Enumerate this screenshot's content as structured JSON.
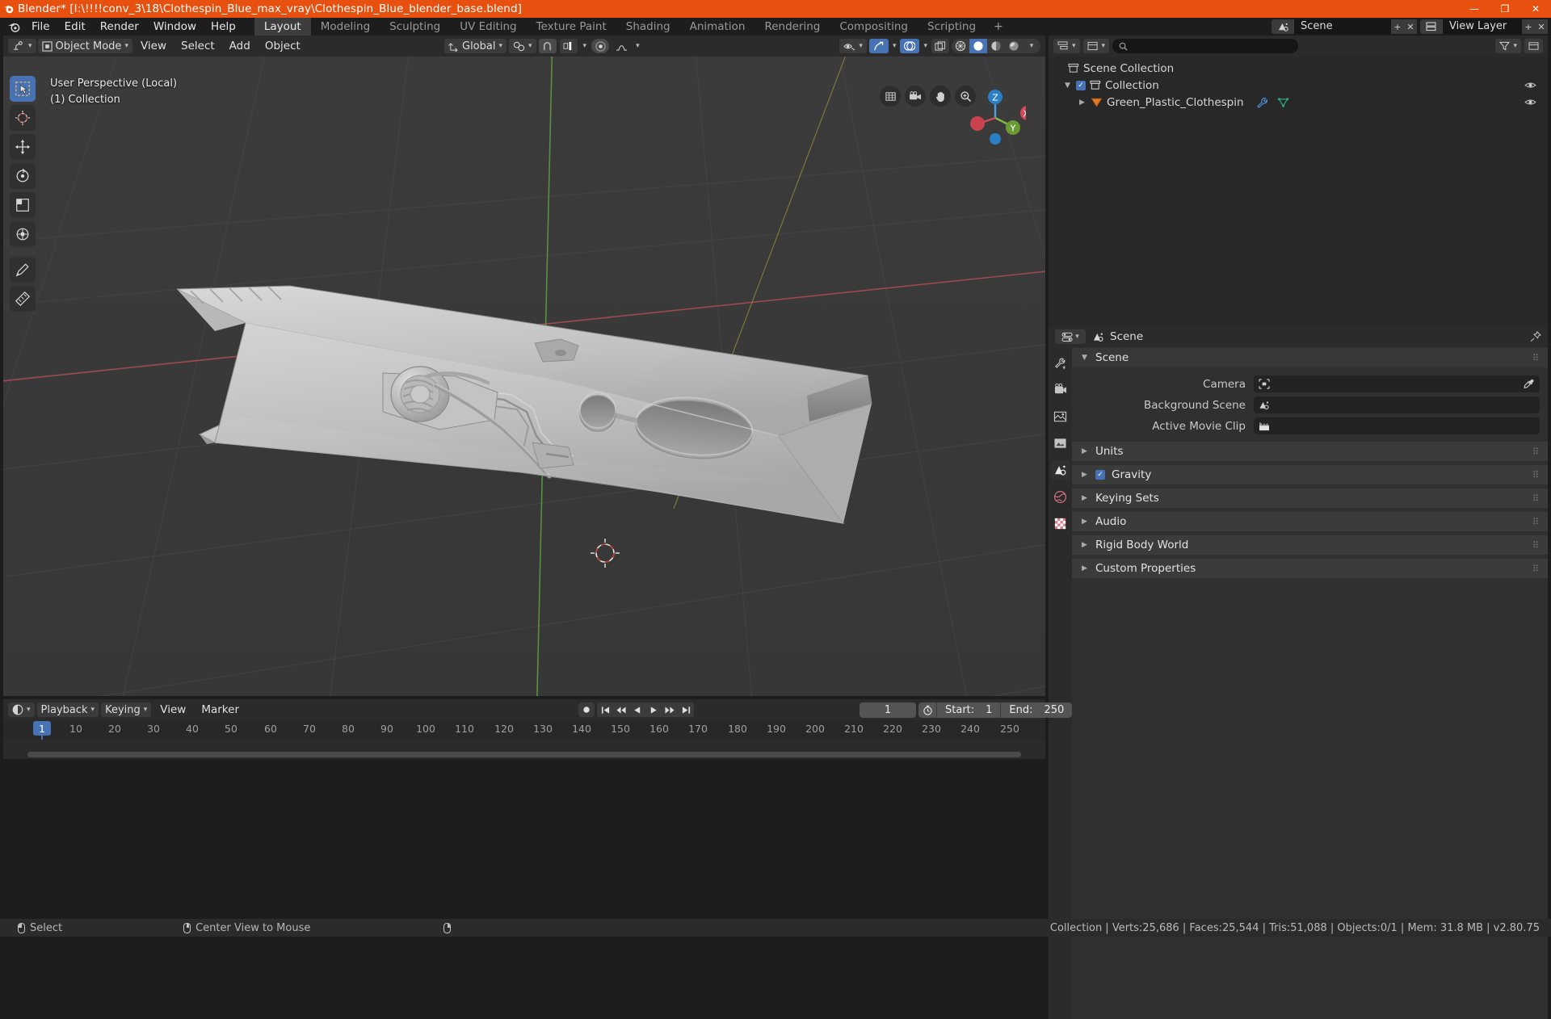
{
  "window": {
    "title": "Blender* [I:\\!!!!conv_3\\18\\Clothespin_Blue_max_vray\\Clothespin_Blue_blender_base.blend]",
    "minimize": "—",
    "maximize": "❐",
    "close": "✕"
  },
  "topbar": {
    "menus": [
      "File",
      "Edit",
      "Render",
      "Window",
      "Help"
    ],
    "workspaces": [
      {
        "label": "Layout",
        "active": true
      },
      {
        "label": "Modeling",
        "active": false
      },
      {
        "label": "Sculpting",
        "active": false
      },
      {
        "label": "UV Editing",
        "active": false
      },
      {
        "label": "Texture Paint",
        "active": false
      },
      {
        "label": "Shading",
        "active": false
      },
      {
        "label": "Animation",
        "active": false
      },
      {
        "label": "Rendering",
        "active": false
      },
      {
        "label": "Compositing",
        "active": false
      },
      {
        "label": "Scripting",
        "active": false
      }
    ],
    "add_workspace": "+",
    "scene_name": "Scene",
    "view_layer_name": "View Layer"
  },
  "viewport": {
    "mode": "Object Mode",
    "menus": [
      "View",
      "Select",
      "Add",
      "Object"
    ],
    "transform_orientation": "Global",
    "overlay_line1": "User Perspective (Local)",
    "overlay_line2": "(1) Collection",
    "gizmo_axes": {
      "x": "X",
      "y": "Y",
      "z": "Z"
    }
  },
  "outliner": {
    "search_placeholder": "",
    "rows": [
      {
        "label": "Scene Collection",
        "indent": 0,
        "icon": "collection-icon",
        "arrow": "",
        "checkbox": false,
        "eye": false,
        "selected": false
      },
      {
        "label": "Collection",
        "indent": 1,
        "icon": "collection-icon",
        "arrow": "▼",
        "checkbox": true,
        "eye": true,
        "selected": false
      },
      {
        "label": "Green_Plastic_Clothespin",
        "indent": 2,
        "icon": "mesh-object-icon",
        "arrow": "▶",
        "checkbox": false,
        "eye": true,
        "selected": false
      }
    ]
  },
  "properties": {
    "editor_label": "properties-editor",
    "title": "Scene",
    "panels": [
      {
        "label": "Scene",
        "open": true,
        "checkbox": null
      },
      {
        "label": "Units",
        "open": false,
        "checkbox": null
      },
      {
        "label": "Gravity",
        "open": false,
        "checkbox": true
      },
      {
        "label": "Keying Sets",
        "open": false,
        "checkbox": null
      },
      {
        "label": "Audio",
        "open": false,
        "checkbox": null
      },
      {
        "label": "Rigid Body World",
        "open": false,
        "checkbox": null
      },
      {
        "label": "Custom Properties",
        "open": false,
        "checkbox": null
      }
    ],
    "fields": [
      {
        "label": "Camera",
        "value": "",
        "icon": "camera-data-icon",
        "eyedropper": true
      },
      {
        "label": "Background Scene",
        "value": "",
        "icon": "scene-icon",
        "eyedropper": false
      },
      {
        "label": "Active Movie Clip",
        "value": "",
        "icon": "movie-clip-icon",
        "eyedropper": false
      }
    ],
    "tabs": [
      "tool-icon",
      "render-icon",
      "output-icon",
      "view-layer-icon",
      "scene-icon",
      "world-icon",
      "texture-icon"
    ]
  },
  "timeline": {
    "menus": [
      "Playback",
      "Keying",
      "View",
      "Marker"
    ],
    "current_frame": "1",
    "start_label": "Start:",
    "start_value": "1",
    "end_label": "End:",
    "end_value": "250",
    "ticks": [
      "10",
      "20",
      "30",
      "40",
      "50",
      "60",
      "70",
      "80",
      "90",
      "100",
      "110",
      "120",
      "130",
      "140",
      "150",
      "160",
      "170",
      "180",
      "190",
      "200",
      "210",
      "220",
      "230",
      "240",
      "250"
    ]
  },
  "statusbar": {
    "left_items": [
      {
        "mouse": "left",
        "label": "Select"
      },
      {
        "mouse": "middle",
        "label": "Center View to Mouse"
      },
      {
        "mouse": "right",
        "label": ""
      }
    ],
    "stats": "Collection | Verts:25,686 | Faces:25,544 | Tris:51,088 | Objects:0/1 | Mem: 31.8 MB | v2.80.75"
  },
  "colors": {
    "accent": "#4772b3",
    "title_bar": "#e8500f",
    "viewport_bg": "#393939",
    "panel_bg": "#303030",
    "header_bg": "#2b2b2b"
  }
}
